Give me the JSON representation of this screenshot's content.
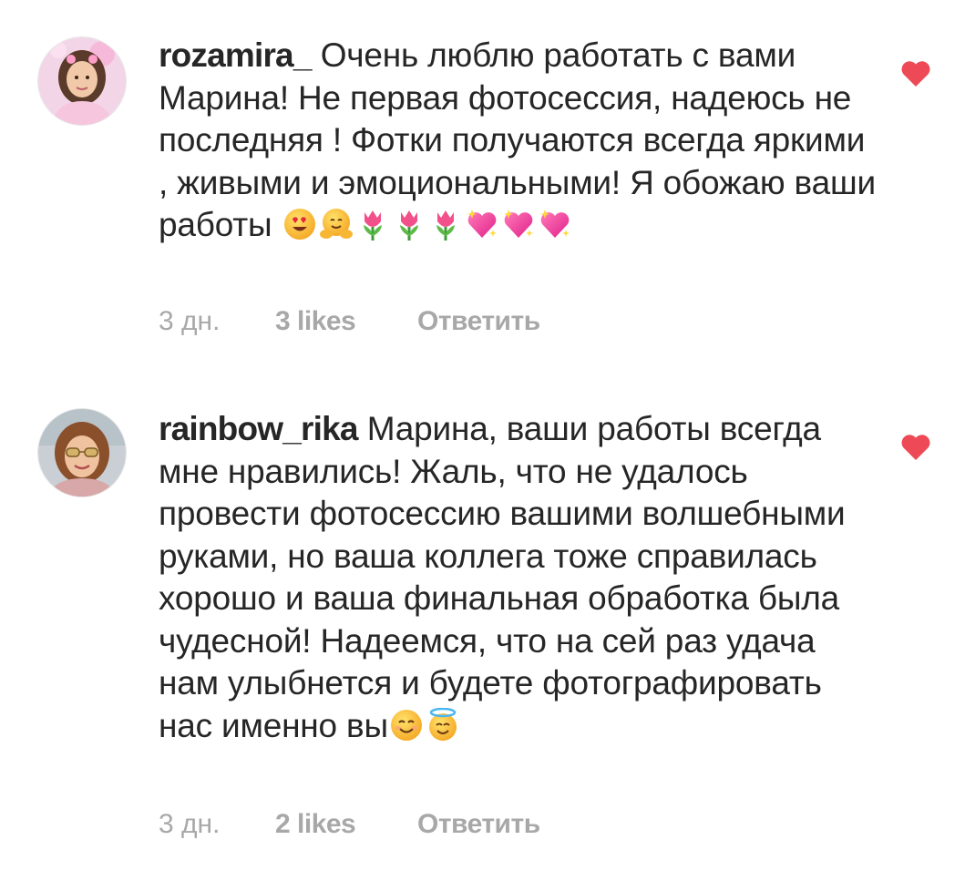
{
  "comments": [
    {
      "username": "rozamira_",
      "text": " Очень люблю работать с вами Марина! Не первая фотосессия, надеюсь не последняя ! Фотки получаются всегда яркими , живыми и эмоциональными! Я обожаю ваши работы ",
      "emojis": [
        "heart-eyes-face",
        "hugging-face",
        "tulip",
        "tulip",
        "tulip",
        "sparkling-heart",
        "sparkling-heart",
        "sparkling-heart"
      ],
      "time": "3 дн.",
      "likes": "3 likes",
      "reply_label": "Ответить",
      "liked": true
    },
    {
      "username": "rainbow_rika",
      "text": " Марина, ваши работы всегда мне нравились! Жаль, что не удалось провести фотосессию вашими волшебными руками, но ваша коллега тоже справилась хорошо и ваша финальная обработка была чудесной! Надеемся, что на сей раз удача нам улыбнется и будете фотографировать нас именно вы",
      "emojis": [
        "smiling-face",
        "halo-face"
      ],
      "time": "3 дн.",
      "likes": "2 likes",
      "reply_label": "Ответить",
      "liked": true
    }
  ],
  "colors": {
    "text": "#262626",
    "secondary": "#a8a8a8",
    "like": "#ed4956"
  }
}
